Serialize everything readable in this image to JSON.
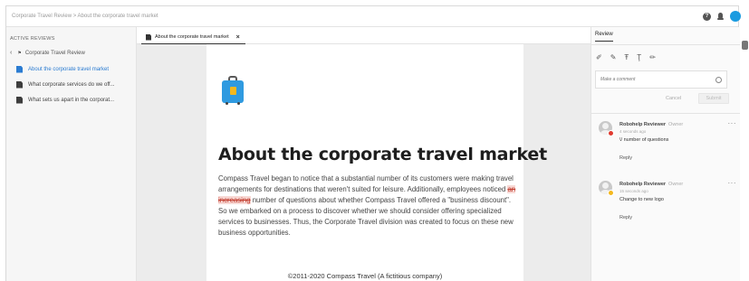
{
  "header": {
    "breadcrumb": "Corporate Travel Review > About the corporate travel market",
    "help_icon": "?",
    "accent_color": "#1a9be0"
  },
  "sidebar": {
    "heading": "ACTIVE REVIEWS",
    "back_label": "Corporate Travel Review",
    "items": [
      {
        "label": "About the corporate travel market",
        "icon": "document-icon",
        "active": true
      },
      {
        "label": "What corporate services do we off...",
        "icon": "document-icon",
        "active": false
      },
      {
        "label": "What sets us apart in the corporat...",
        "icon": "document-icon",
        "active": false
      }
    ]
  },
  "editor": {
    "tab_label": "About the corporate travel market",
    "tab_close": "×",
    "title": "About the corporate travel market",
    "para_before_strike": "Compass Travel began to notice that a substantial number of its customers were making travel arrangements for destinations that weren't suited for leisure. Additionally, employees noticed ",
    "strike_text": "an increasing",
    "para_after_strike": " number of questions about whether Compass Travel offered a \"business discount\". So we embarked on a process to discover whether we should consider offering specialized services to businesses. Thus, the Corporate Travel division was created to focus on these new business opportunities.",
    "footer": "©2011-2020 Compass Travel (A fictitious company)",
    "strike_color": "#c0392b"
  },
  "review": {
    "tab_label": "Review",
    "comment_placeholder": "Make a comment",
    "cancel_label": "Cancel",
    "submit_label": "Submit",
    "reply_label": "Reply",
    "comments": [
      {
        "author": "Robohelp Reviewer",
        "role": "Owner",
        "time": "4 seconds ago",
        "text": "\\/ number of questions",
        "badge_color": "#e03a2f"
      },
      {
        "author": "Robohelp Reviewer",
        "role": "Owner",
        "time": "15 seconds ago",
        "text": "Change to new logo",
        "badge_color": "#f4b81e"
      }
    ]
  }
}
